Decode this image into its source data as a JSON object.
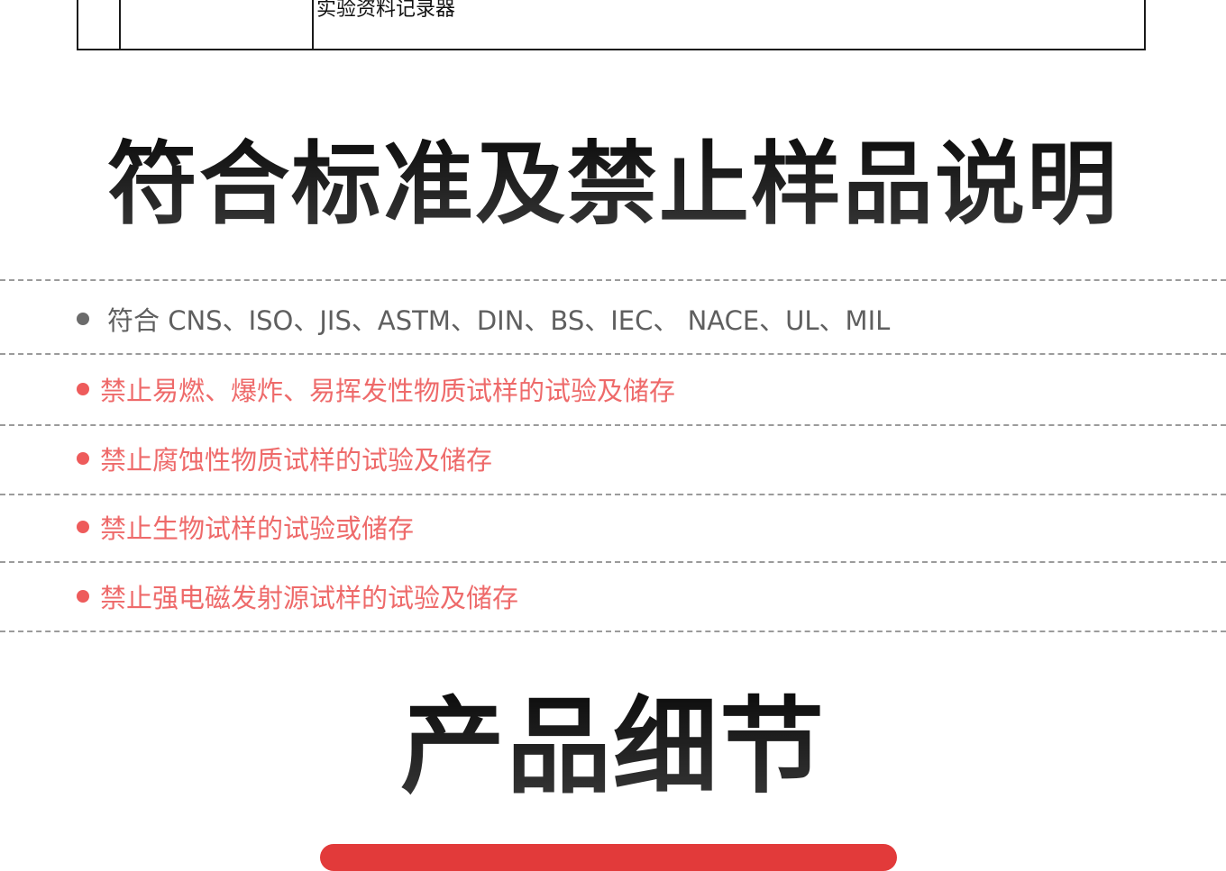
{
  "table": {
    "cell_text": "实验资料记录器"
  },
  "standards_section": {
    "title": "符合标准及禁止样品说明",
    "items": [
      {
        "text": "符合 CNS、ISO、JIS、ASTM、DIN、BS、IEC、 NACE、UL、MIL",
        "style": "neutral"
      },
      {
        "text": "禁止易燃、爆炸、易挥发性物质试样的试验及储存",
        "style": "warn"
      },
      {
        "text": "禁止腐蚀性物质试样的试验及储存",
        "style": "warn"
      },
      {
        "text": "禁止生物试样的试验或储存",
        "style": "warn"
      },
      {
        "text": "禁止强电磁发射源试样的试验及储存",
        "style": "warn"
      }
    ]
  },
  "details_section": {
    "title": "产品细节"
  },
  "colors": {
    "warn_text": "#ee6a6a",
    "neutral_text": "#5f5f5f",
    "accent_bar": "#e23a3a",
    "title": "#1c1c1c"
  }
}
